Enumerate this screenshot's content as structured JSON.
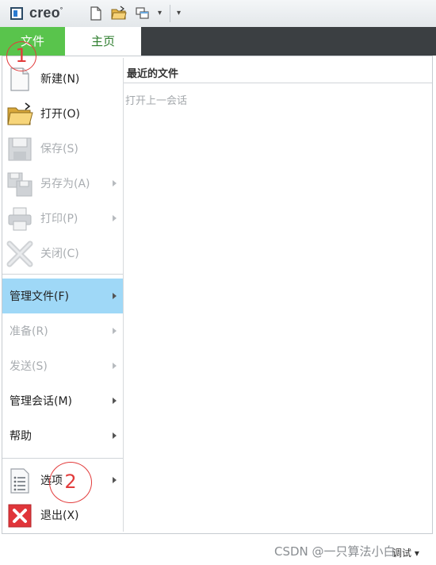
{
  "app": {
    "logo_text": "creo",
    "logo_mark": "°"
  },
  "toolbar": {
    "icons": [
      "new-file-icon",
      "open-folder-icon",
      "window-switch-icon",
      "dropdown-caret-icon",
      "customize-caret-icon"
    ]
  },
  "tabs": [
    {
      "label": "文件",
      "active": true
    },
    {
      "label": "主页",
      "active": false
    }
  ],
  "menu": {
    "items": [
      {
        "label": "新建(N)",
        "enabled": true
      },
      {
        "label": "打开(O)",
        "enabled": true
      },
      {
        "label": "保存(S)",
        "enabled": false
      },
      {
        "label": "另存为(A)",
        "enabled": false,
        "submenu": true
      },
      {
        "label": "打印(P)",
        "enabled": false,
        "submenu": true
      },
      {
        "label": "关闭(C)",
        "enabled": false
      },
      {
        "label": "管理文件(F)",
        "enabled": true,
        "submenu": true,
        "highlighted": true
      },
      {
        "label": "准备(R)",
        "enabled": false,
        "submenu": true
      },
      {
        "label": "发送(S)",
        "enabled": false,
        "submenu": true
      },
      {
        "label": "管理会话(M)",
        "enabled": true,
        "submenu": true
      },
      {
        "label": "帮助",
        "enabled": true,
        "submenu": true
      },
      {
        "label": "选项",
        "enabled": true,
        "submenu": true
      },
      {
        "label": "退出(X)",
        "enabled": true
      }
    ]
  },
  "recent": {
    "title": "最近的文件",
    "empty_text": "打开上一会话"
  },
  "annotations": [
    {
      "label": "1"
    },
    {
      "label": "2"
    }
  ],
  "status": {
    "watermark": "CSDN @一只算法小白",
    "debug_label": "调试"
  },
  "colors": {
    "file_tab": "#59c44c",
    "tabbar": "#3b3f42",
    "highlight": "#9fd8f7",
    "annotation": "#e23b3b",
    "home_tab_text": "#2d7d2d"
  }
}
